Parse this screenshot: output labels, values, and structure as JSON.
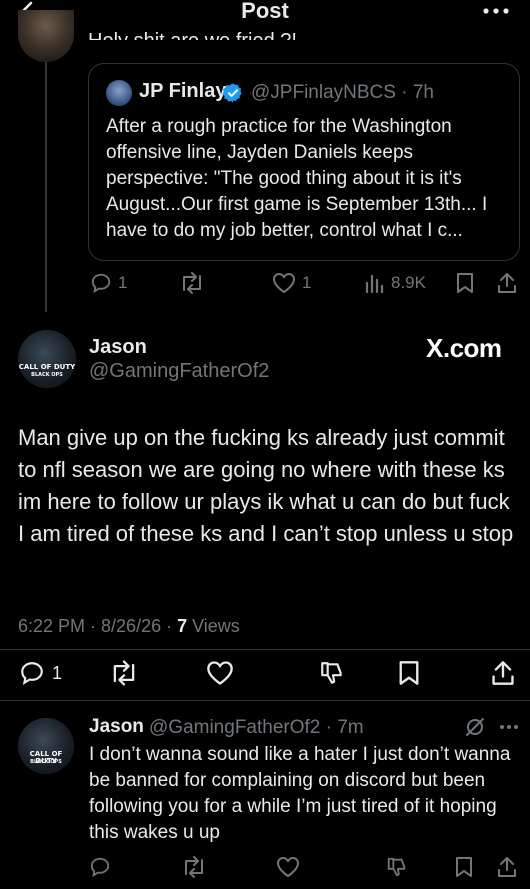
{
  "header": {
    "title": "Post"
  },
  "prev_post": {
    "text_fragment": "Holy shit are we fried ?!"
  },
  "quote": {
    "name": "JP Finlay",
    "handle_time": "@JPFinlayNBCS · 7h",
    "text": "After a rough practice for the Washington offensive line, Jayden Daniels keeps perspective: \"The good thing about it is it's August...Our first game is September 13th... I have to do my job better, control what I c..."
  },
  "prev_actions": {
    "replies": "1",
    "likes": "1",
    "views": "8.9K"
  },
  "main_post": {
    "name": "Jason",
    "handle": "@GamingFatherOf2",
    "watermark": "X.com",
    "avatar_text": [
      "CALL OF DUTY",
      "BLACK OPS"
    ],
    "text": "Man give up on the fucking ks already just commit to nfl season we are going no where with these ks im here to follow ur plays ik what u can do but fuck I am tired of these ks and I can’t stop unless u stop",
    "time_date": "6:22 PM · 8/26/26 · ",
    "views_count": "7",
    "views_label": " Views",
    "replies": "1"
  },
  "reply": {
    "name": "Jason",
    "handle_time": "@GamingFatherOf2 · 7m",
    "text": "I don’t wanna sound like a hater I just don’t wanna be banned for complaining on discord but been following you for a while I’m just tired of it hoping this wakes u up"
  },
  "colors": {
    "accent": "#1d9bf0",
    "background": "#000000",
    "muted": "#71767b",
    "text": "#e7e9ea"
  },
  "icons": [
    "back-arrow-icon",
    "more-icon",
    "verified-icon",
    "reply-icon",
    "repost-icon",
    "like-icon",
    "views-icon",
    "bookmark-icon",
    "share-icon",
    "grok-icon",
    "dislike-icon"
  ]
}
